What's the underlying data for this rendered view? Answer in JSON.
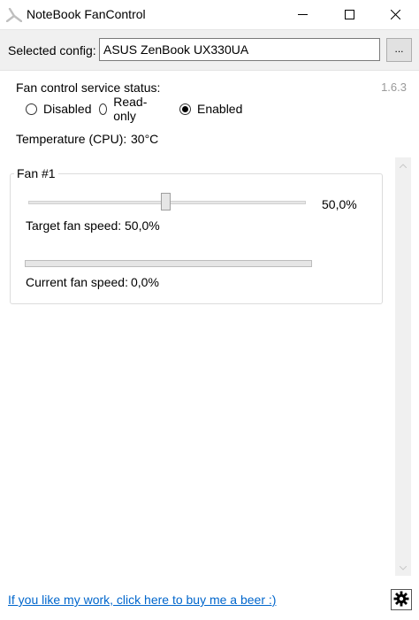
{
  "window": {
    "title": "NoteBook FanControl"
  },
  "config": {
    "label": "Selected config:",
    "value": "ASUS ZenBook UX330UA",
    "browse_label": "..."
  },
  "version": "1.6.3",
  "service_status": {
    "heading": "Fan control service status:",
    "options": [
      {
        "label": "Disabled",
        "checked": false
      },
      {
        "label": "Read-only",
        "checked": false
      },
      {
        "label": "Enabled",
        "checked": true
      }
    ]
  },
  "temperature": {
    "label": "Temperature (CPU):",
    "value": "30°C"
  },
  "fan": {
    "title": "Fan #1",
    "slider_value": "50,0%",
    "slider_level": 0.5,
    "target_label": "Target fan speed:",
    "target_value": "50,0%",
    "current_label": "Current fan speed:",
    "current_value": "0,0%",
    "current_level": 0.0
  },
  "footer": {
    "link_text": "If you like my work, click here to buy me a beer :)"
  },
  "icons": {
    "app": "fan-icon",
    "minimize": "minimize-icon",
    "maximize": "maximize-icon",
    "close": "close-icon",
    "settings": "gear-icon"
  },
  "colors": {
    "link": "#0066cc",
    "version": "#9a9a9a",
    "progress_fill": "#06b025"
  }
}
